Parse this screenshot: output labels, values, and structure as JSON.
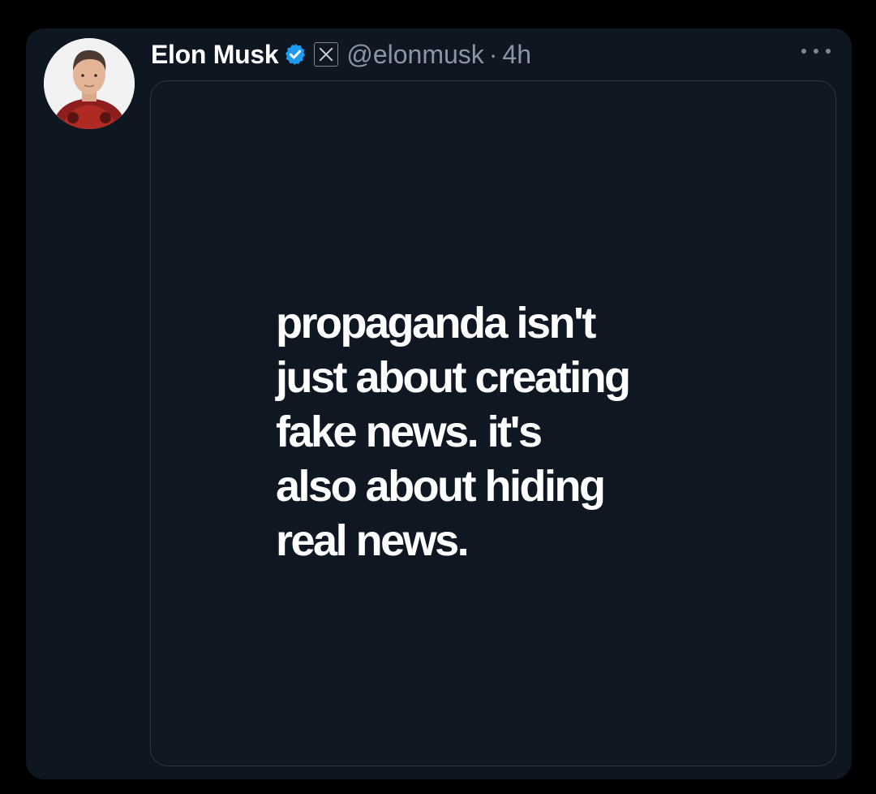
{
  "post": {
    "author_name": "Elon Musk",
    "handle": "@elonmusk",
    "separator": "·",
    "time": "4h",
    "verified": true,
    "platform_icon": "x-logo-icon",
    "more_icon": "ellipsis-icon",
    "colors": {
      "background": "#0e1621",
      "verified_badge": "#1d9bf0",
      "secondary_text": "#8a96a3"
    },
    "media": {
      "lines": [
        "propaganda isn't",
        "just about creating",
        "fake news. it's",
        "also about hiding",
        "real news."
      ]
    }
  }
}
